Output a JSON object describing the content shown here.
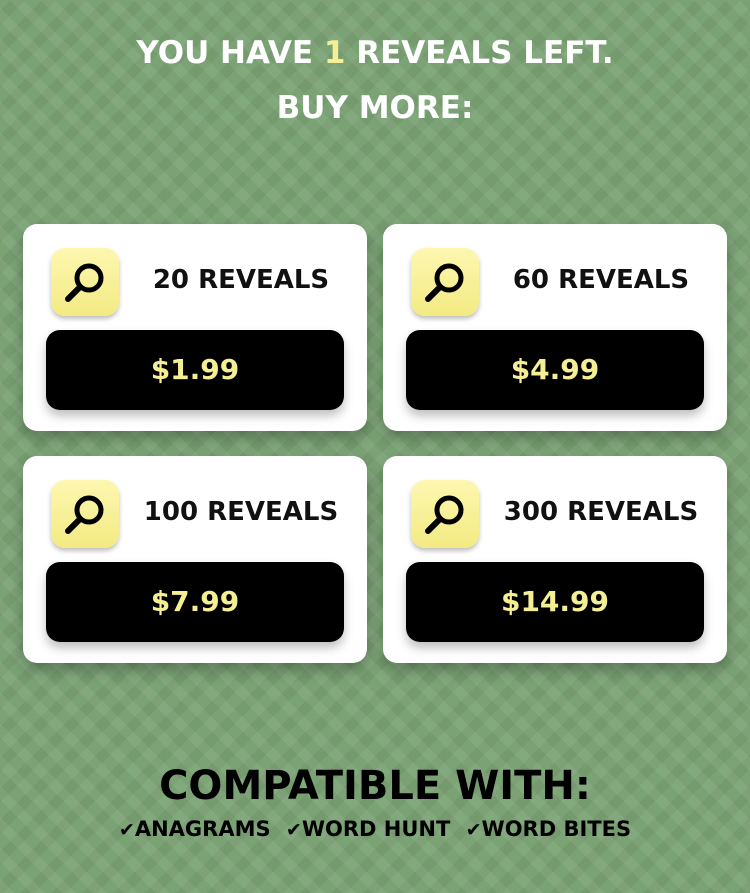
{
  "header": {
    "line1_prefix": "YOU HAVE",
    "reveals_left": "1",
    "line1_suffix": "REVEALS LEFT.",
    "line2": "BUY MORE:"
  },
  "packs": [
    {
      "label": "20 REVEALS",
      "price": "$1.99",
      "icon": "magnifying-glass-icon"
    },
    {
      "label": "60 REVEALS",
      "price": "$4.99",
      "icon": "magnifying-glass-icon"
    },
    {
      "label": "100 REVEALS",
      "price": "$7.99",
      "icon": "magnifying-glass-icon"
    },
    {
      "label": "300 REVEALS",
      "price": "$14.99",
      "icon": "magnifying-glass-icon"
    }
  ],
  "footer": {
    "title": "COMPATIBLE WITH:",
    "check_glyph": "✔",
    "games": [
      "ANAGRAMS",
      "WORD HUNT",
      "WORD BITES"
    ]
  },
  "colors": {
    "background": "#7aa274",
    "accent_yellow": "#f4ee94",
    "card": "#ffffff",
    "button": "#000000"
  }
}
